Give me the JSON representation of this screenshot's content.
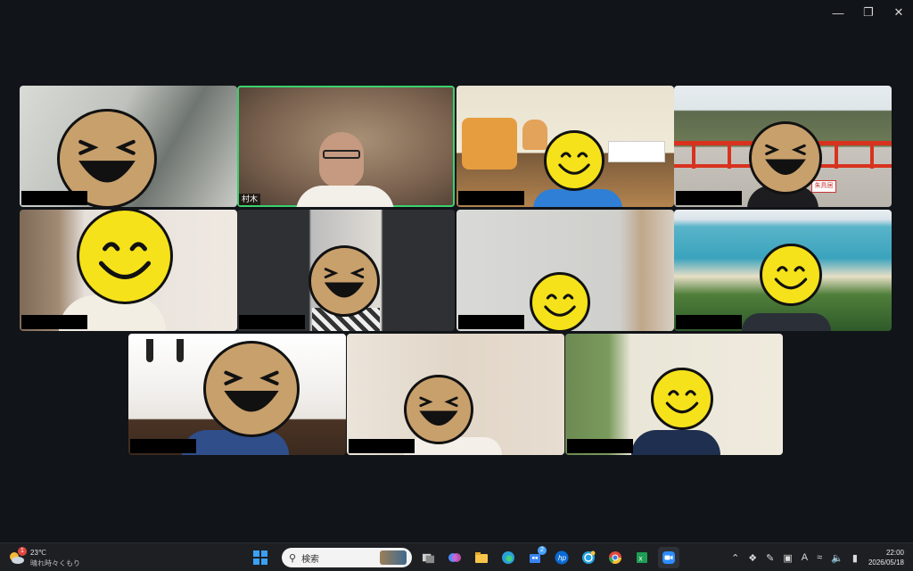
{
  "window": {
    "minimize_icon": "minimize-icon",
    "restore_icon": "restore-icon",
    "close_icon": "close-icon"
  },
  "meeting": {
    "active_speaker_label": "村木",
    "participants": [
      {
        "tile": 1,
        "mask": "laugh"
      },
      {
        "tile": 2,
        "mask": "none",
        "name": "村木",
        "speaking": true
      },
      {
        "tile": 3,
        "mask": "smile"
      },
      {
        "tile": 4,
        "mask": "laugh",
        "sign": "朱鳥居"
      },
      {
        "tile": 5,
        "mask": "smile"
      },
      {
        "tile": 6,
        "mask": "laugh"
      },
      {
        "tile": 7,
        "mask": "smile"
      },
      {
        "tile": 8,
        "mask": "smile"
      },
      {
        "tile": 9,
        "mask": "laugh"
      },
      {
        "tile": 10,
        "mask": "laugh"
      },
      {
        "tile": 11,
        "mask": "smile"
      }
    ]
  },
  "taskbar": {
    "weather": {
      "temp": "23℃",
      "condition": "晴れ時々くもり",
      "badge": "1"
    },
    "search_placeholder": "検索",
    "apps": [
      {
        "name": "start-icon"
      },
      {
        "name": "task-view-icon"
      },
      {
        "name": "copilot-icon"
      },
      {
        "name": "file-explorer-icon"
      },
      {
        "name": "edge-icon"
      },
      {
        "name": "store-icon",
        "badge": "2"
      },
      {
        "name": "hp-icon"
      },
      {
        "name": "whatsapp-icon"
      },
      {
        "name": "chrome-icon"
      },
      {
        "name": "excel-icon"
      },
      {
        "name": "zoom-icon",
        "active": true
      }
    ],
    "tray": {
      "ime": "A"
    },
    "clock": {
      "time": "22:00",
      "date": "2026/05/18"
    }
  }
}
